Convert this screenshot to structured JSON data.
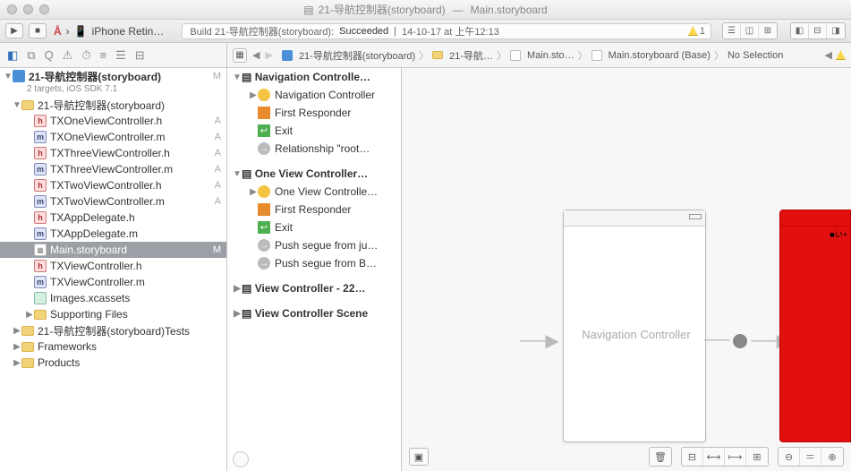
{
  "window": {
    "file_icon": "📄",
    "title_left": "21-导航控制器(storyboard)",
    "dash": "—",
    "title_right": "Main.storyboard"
  },
  "toolbar": {
    "run": "▶",
    "stop": "■",
    "scheme_icon": "Å",
    "scheme_sep": "›",
    "scheme_dest": "iPhone Retin…",
    "build_prefix": "Build 21-导航控制器(storyboard):",
    "build_status": "Succeeded",
    "build_sep": "|",
    "build_time": "14-10-17 at 上午12:13",
    "warn_count": "1"
  },
  "mini_icons": [
    "◧",
    "⧉",
    "Q",
    "⚠︎",
    "⏱",
    "≡",
    "☰",
    "⊟"
  ],
  "jumpbar": {
    "grid": "▦",
    "back": "◀",
    "fwd": "▶",
    "item1": "21-导航控制器(storyboard)",
    "item2": "21-导航…",
    "item3": "Main.sto…",
    "item4": "Main.storyboard (Base)",
    "item5": "No Selection"
  },
  "project": {
    "name": "21-导航控制器(storyboard)",
    "sub": "2 targets, iOS SDK 7.1",
    "badge": "M",
    "group1": "21-导航控制器(storyboard)",
    "files": [
      {
        "t": "h",
        "n": "TXOneViewController.h",
        "b": "A"
      },
      {
        "t": "m",
        "n": "TXOneViewController.m",
        "b": "A"
      },
      {
        "t": "h",
        "n": "TXThreeViewController.h",
        "b": "A"
      },
      {
        "t": "m",
        "n": "TXThreeViewController.m",
        "b": "A"
      },
      {
        "t": "h",
        "n": "TXTwoViewController.h",
        "b": "A"
      },
      {
        "t": "m",
        "n": "TXTwoViewController.m",
        "b": "A"
      },
      {
        "t": "h",
        "n": "TXAppDelegate.h",
        "b": ""
      },
      {
        "t": "m",
        "n": "TXAppDelegate.m",
        "b": ""
      },
      {
        "t": "sb",
        "n": "Main.storyboard",
        "b": "M",
        "sel": true
      },
      {
        "t": "h",
        "n": "TXViewController.h",
        "b": ""
      },
      {
        "t": "m",
        "n": "TXViewController.m",
        "b": ""
      },
      {
        "t": "as",
        "n": "Images.xcassets",
        "b": ""
      }
    ],
    "folders": [
      "Supporting Files",
      "21-导航控制器(storyboard)Tests",
      "Frameworks",
      "Products"
    ]
  },
  "outline": {
    "s1_title": "Navigation Controlle…",
    "s1": [
      "Navigation Controller",
      "First Responder",
      "Exit",
      "Relationship \"root…"
    ],
    "s2_title": "One View Controller…",
    "s2": [
      "One View Controlle…",
      "First Responder",
      "Exit",
      "Push segue from ju…",
      "Push segue from B…"
    ],
    "s3_title": "View Controller - 22…",
    "s4_title": "View Controller Scene"
  },
  "canvas": {
    "nav_label": "Navigation Controller",
    "red_label": "■い+"
  }
}
